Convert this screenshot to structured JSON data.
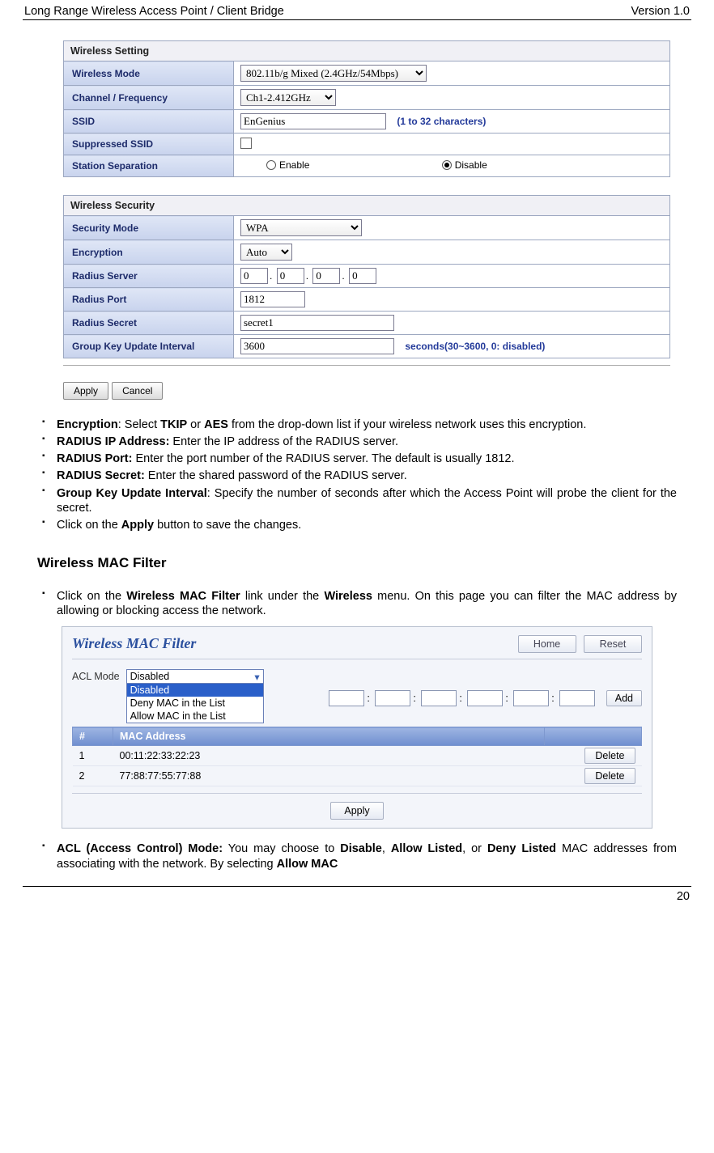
{
  "page_header": {
    "left": "Long Range Wireless Access Point / Client Bridge",
    "right": "Version 1.0"
  },
  "page_footer": {
    "number": "20"
  },
  "wireless_setting": {
    "section_title": "Wireless Setting",
    "rows": {
      "mode": {
        "label": "Wireless Mode",
        "value": "802.11b/g Mixed (2.4GHz/54Mbps)"
      },
      "channel": {
        "label": "Channel / Frequency",
        "value": "Ch1-2.412GHz"
      },
      "ssid": {
        "label": "SSID",
        "value": "EnGenius",
        "hint": "(1 to 32 characters)"
      },
      "supp": {
        "label": "Suppressed SSID"
      },
      "sep": {
        "label": "Station Separation",
        "opt_enable": "Enable",
        "opt_disable": "Disable"
      }
    }
  },
  "wireless_security": {
    "section_title": "Wireless Security",
    "rows": {
      "secmode": {
        "label": "Security Mode",
        "value": "WPA"
      },
      "enc": {
        "label": "Encryption",
        "value": "Auto"
      },
      "radius": {
        "label": "Radius Server",
        "o1": "0",
        "o2": "0",
        "o3": "0",
        "o4": "0"
      },
      "rport": {
        "label": "Radius Port",
        "value": "1812"
      },
      "rsecret": {
        "label": "Radius Secret",
        "value": "secret1"
      },
      "gku": {
        "label": "Group Key Update Interval",
        "value": "3600",
        "hint": "seconds(30~3600, 0: disabled)"
      }
    }
  },
  "buttons": {
    "apply": "Apply",
    "cancel": "Cancel"
  },
  "instr": {
    "l1a": "Encryption",
    "l1b": ": Select ",
    "l1c": "TKIP",
    "l1d": " or ",
    "l1e": "AES",
    "l1f": " from the drop-down list if your wireless network uses this encryption.",
    "l2a": "RADIUS IP Address:",
    "l2b": " Enter the IP address of the RADIUS server.",
    "l3a": "RADIUS Port:",
    "l3b": " Enter the port number of the RADIUS server. The default is usually 1812.",
    "l4a": "RADIUS Secret:",
    "l4b": " Enter the shared password of the RADIUS server.",
    "l5a": "Group Key Update Interval",
    "l5b": ": Specify the number of seconds after which the Access Point will probe the client for the secret.",
    "l6a": "Click on the ",
    "l6b": "Apply",
    "l6c": " button to save the changes."
  },
  "mac_section_title": "Wireless MAC Filter",
  "mac_intro": {
    "a": "Click on the ",
    "b": "Wireless MAC Filter",
    "c": " link under the ",
    "d": "Wireless",
    "e": " menu. On this page you can filter the MAC address by allowing or blocking access the network."
  },
  "mac_panel": {
    "title": "Wireless MAC Filter",
    "home": "Home",
    "reset": "Reset",
    "acl_label": "ACL Mode",
    "acl_selected": "Disabled",
    "acl_options": [
      "Disabled",
      "Deny MAC in the List",
      "Allow MAC in the List"
    ],
    "add": "Add",
    "th_num": "#",
    "th_mac": "MAC Address",
    "rows": [
      {
        "num": "1",
        "mac": "00:11:22:33:22:23",
        "del": "Delete"
      },
      {
        "num": "2",
        "mac": "77:88:77:55:77:88",
        "del": "Delete"
      }
    ],
    "apply": "Apply"
  },
  "instr2": {
    "a": "ACL (Access Control) Mode:",
    "b": " You may choose to ",
    "c": "Disable",
    "d": ", ",
    "e": "Allow Listed",
    "f": ", or ",
    "g": "Deny Listed",
    "h": " MAC addresses from associating with the network. By selecting ",
    "i": "Allow MAC"
  }
}
